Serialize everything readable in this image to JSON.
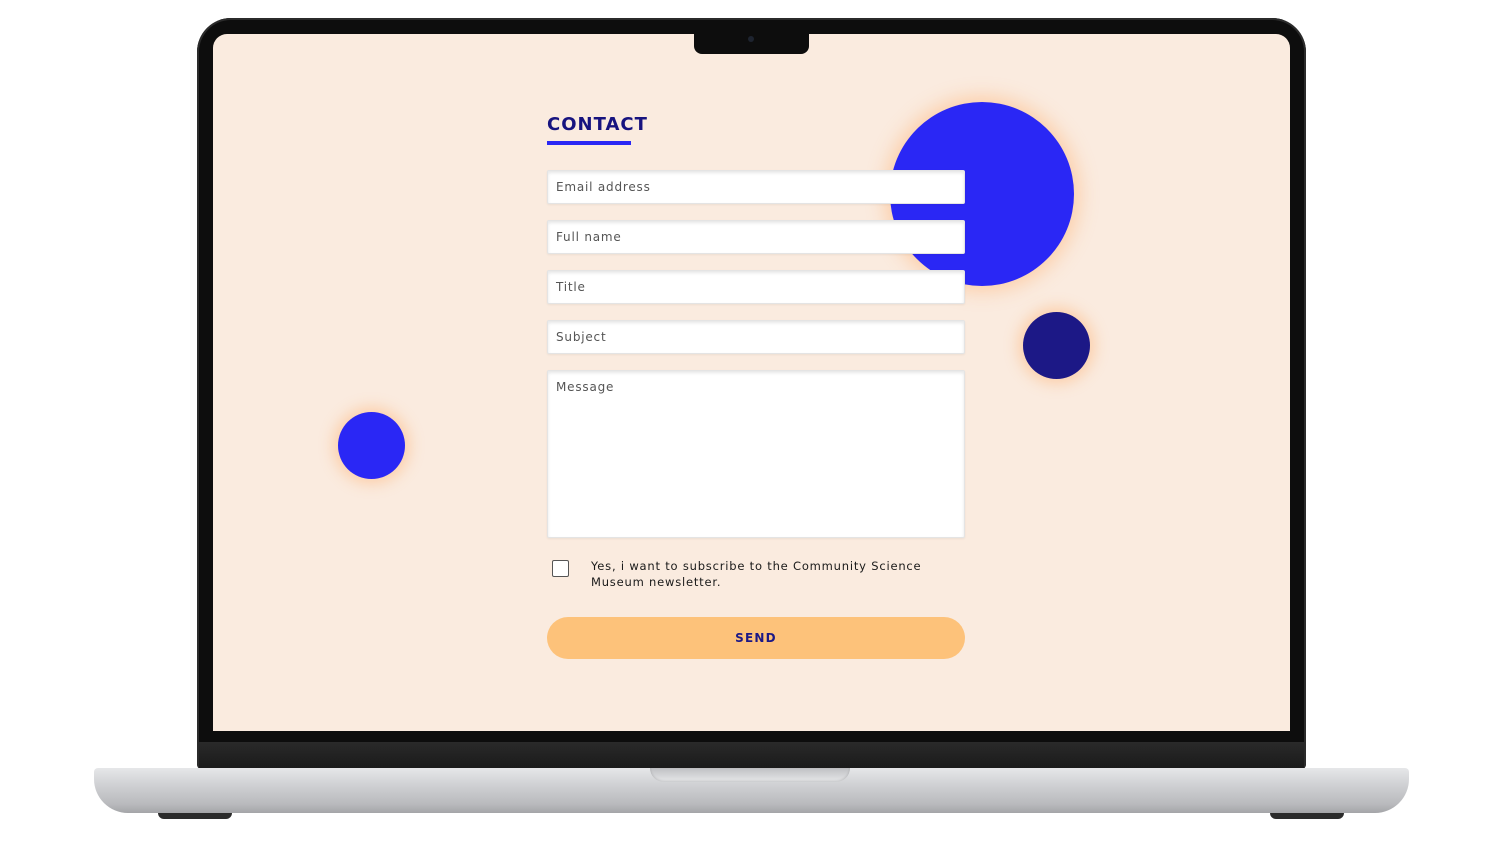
{
  "page": {
    "heading": "CONTACT"
  },
  "form": {
    "email_placeholder": "Email address",
    "name_placeholder": "Full name",
    "title_placeholder": "Title",
    "subject_placeholder": "Subject",
    "message_placeholder": "Message",
    "newsletter_label": "Yes, i want to subscribe to the Community Science Museum newsletter.",
    "newsletter_checked": false,
    "send_label": "SEND"
  },
  "colors": {
    "background": "#faebdf",
    "accent_blue": "#2a27f5",
    "navy": "#1c1886",
    "button": "#fdc27a"
  }
}
